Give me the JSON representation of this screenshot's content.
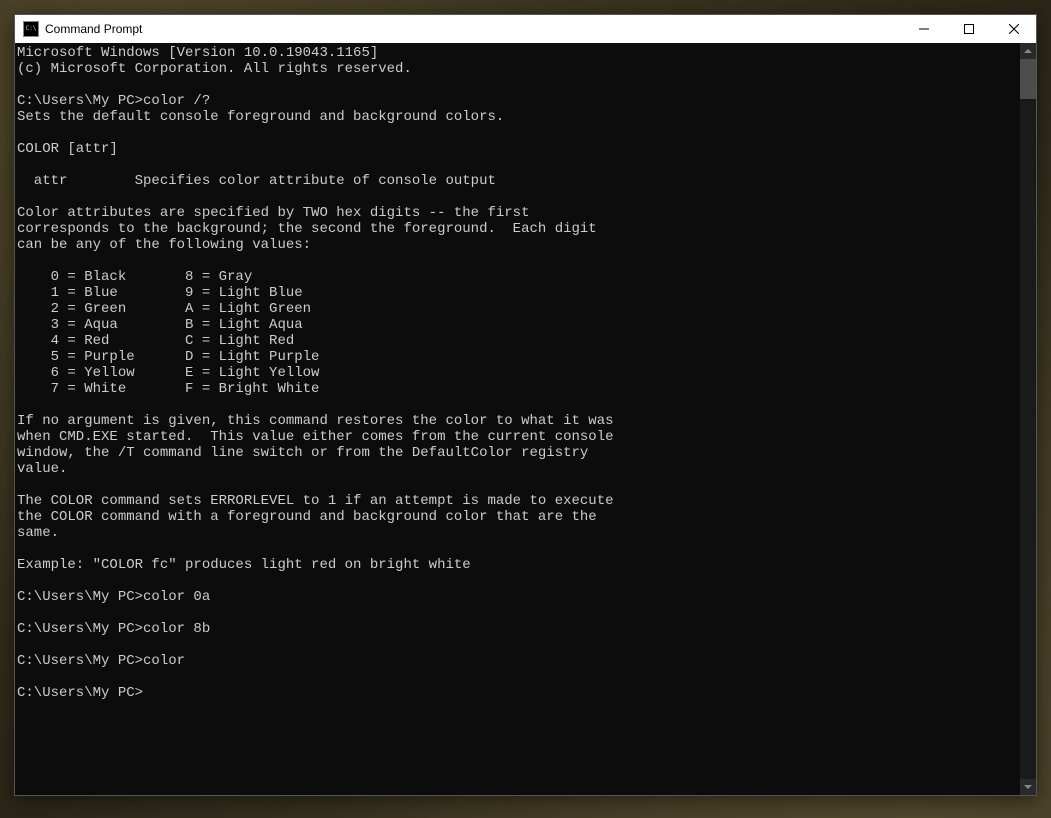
{
  "window": {
    "title": "Command Prompt"
  },
  "console": {
    "lines": [
      "Microsoft Windows [Version 10.0.19043.1165]",
      "(c) Microsoft Corporation. All rights reserved.",
      "",
      "C:\\Users\\My PC>color /?",
      "Sets the default console foreground and background colors.",
      "",
      "COLOR [attr]",
      "",
      "  attr        Specifies color attribute of console output",
      "",
      "Color attributes are specified by TWO hex digits -- the first",
      "corresponds to the background; the second the foreground.  Each digit",
      "can be any of the following values:",
      "",
      "    0 = Black       8 = Gray",
      "    1 = Blue        9 = Light Blue",
      "    2 = Green       A = Light Green",
      "    3 = Aqua        B = Light Aqua",
      "    4 = Red         C = Light Red",
      "    5 = Purple      D = Light Purple",
      "    6 = Yellow      E = Light Yellow",
      "    7 = White       F = Bright White",
      "",
      "If no argument is given, this command restores the color to what it was",
      "when CMD.EXE started.  This value either comes from the current console",
      "window, the /T command line switch or from the DefaultColor registry",
      "value.",
      "",
      "The COLOR command sets ERRORLEVEL to 1 if an attempt is made to execute",
      "the COLOR command with a foreground and background color that are the",
      "same.",
      "",
      "Example: \"COLOR fc\" produces light red on bright white",
      "",
      "C:\\Users\\My PC>color 0a",
      "",
      "C:\\Users\\My PC>color 8b",
      "",
      "C:\\Users\\My PC>color",
      "",
      "C:\\Users\\My PC>"
    ]
  }
}
